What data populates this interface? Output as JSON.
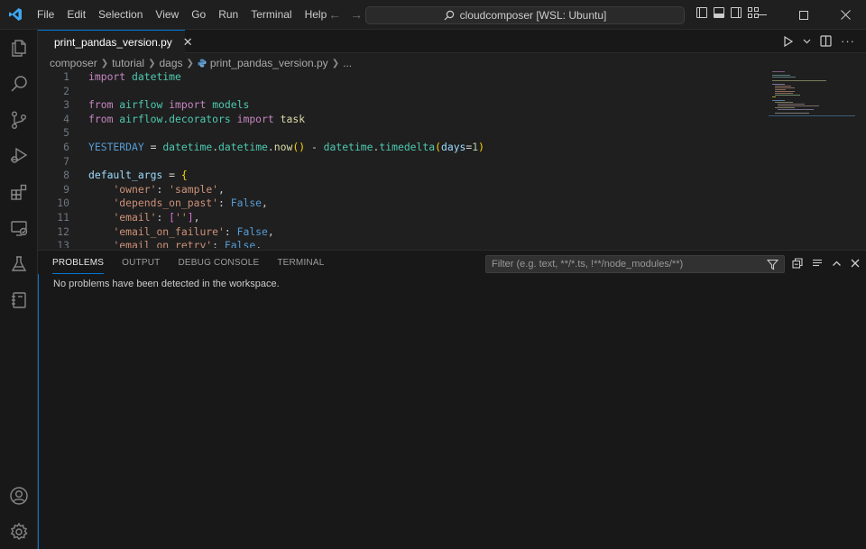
{
  "titlebar": {
    "menu": [
      "File",
      "Edit",
      "Selection",
      "View",
      "Go",
      "Run",
      "Terminal",
      "Help"
    ],
    "command_center": "cloudcomposer [WSL: Ubuntu]",
    "window_buttons": [
      "minimize",
      "maximize",
      "close"
    ]
  },
  "activity_bar": {
    "top": [
      "files-icon",
      "search-icon",
      "source-control-icon",
      "run-debug-icon",
      "extensions-icon",
      "remote-explorer-icon",
      "testing-icon",
      "notebook-icon"
    ],
    "bottom": [
      "accounts-icon",
      "manage-gear-icon"
    ]
  },
  "editor": {
    "tab_label": "print_pandas_version.py",
    "breadcrumb": [
      "composer",
      "tutorial",
      "dags",
      "print_pandas_version.py",
      "..."
    ],
    "line_numbers": [
      "1",
      "2",
      "3",
      "4",
      "5",
      "6",
      "7",
      "8",
      "9",
      "10",
      "11",
      "12",
      "13"
    ]
  },
  "panel": {
    "tabs": [
      "PROBLEMS",
      "OUTPUT",
      "DEBUG CONSOLE",
      "TERMINAL"
    ],
    "active_tab": "PROBLEMS",
    "filter_placeholder": "Filter (e.g. text, **/*.ts, !**/node_modules/**)",
    "message": "No problems have been detected in the workspace."
  },
  "colors": {
    "accent": "#0078d4",
    "keyword": "#c586c0",
    "module": "#4ec9b0",
    "variable": "#9cdcfe",
    "function": "#dcdcaa",
    "string": "#ce9178",
    "constant": "#569cd6",
    "number": "#b5cea8"
  }
}
